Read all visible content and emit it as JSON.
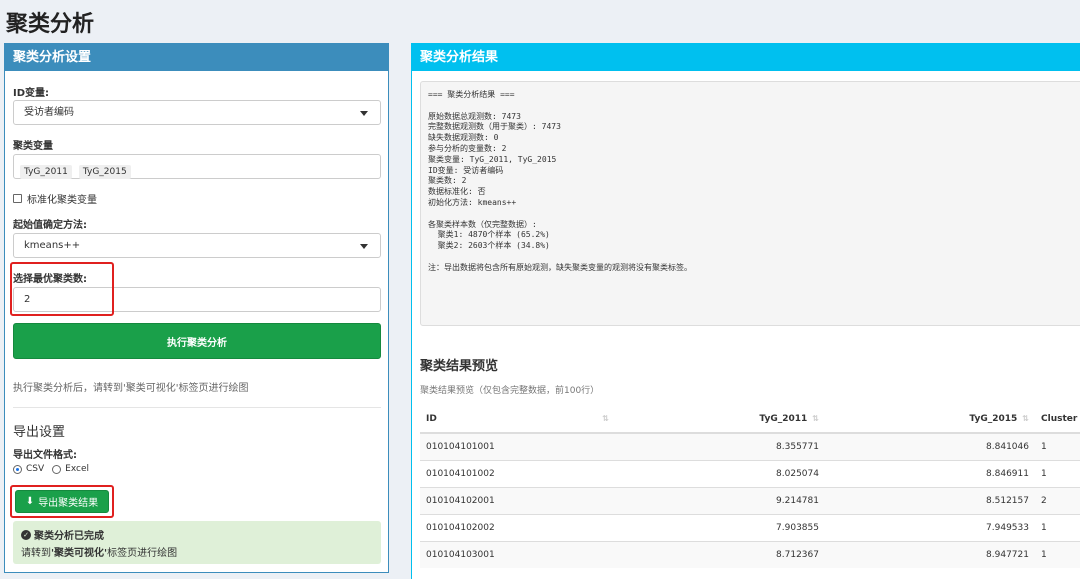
{
  "page_title": "聚类分析",
  "left_panel": {
    "header": "聚类分析设置",
    "id_var_label": "ID变量:",
    "id_var_value": "受访者编码",
    "cluster_var_label": "聚类变量",
    "cluster_vars": [
      "TyG_2011",
      "TyG_2015"
    ],
    "standardize_label": "标准化聚类变量",
    "init_label": "起始值确定方法:",
    "init_value": "kmeans++",
    "k_label": "选择最优聚类数:",
    "k_value": "2",
    "run_button": "执行聚类分析",
    "hint": "执行聚类分析后，请转到'聚类可视化'标签页进行绘图",
    "export_title": "导出设置",
    "format_label": "导出文件格式:",
    "format_options": [
      "CSV",
      "Excel"
    ],
    "format_selected": "CSV",
    "export_button": "导出聚类结果",
    "done_title": "聚类分析已完成",
    "done_msg_prefix": "请转到",
    "done_msg_bold": "'聚类可视化'",
    "done_msg_suffix": "标签页进行绘图",
    "accent_color": "#3c8dbc",
    "button_color": "#1aa04a",
    "highlight_color": "#e0201f"
  },
  "right_panel": {
    "header": "聚类分析结果",
    "output_text": "=== 聚类分析结果 ===\n\n原始数据总观测数: 7473\n完整数据观测数（用于聚类）: 7473\n缺失数据观测数: 0\n参与分析的变量数: 2\n聚类变量: TyG_2011, TyG_2015\nID变量: 受访者编码\n聚类数: 2\n数据标准化: 否\n初始化方法: kmeans++\n\n各聚类样本数（仅完整数据）:\n  聚类1: 4870个样本 (65.2%)\n  聚类2: 2603个样本 (34.8%)\n\n注：导出数据将包含所有原始观测，缺失聚类变量的观测将没有聚类标签。",
    "preview_title": "聚类结果预览",
    "preview_subtitle": "聚类结果预览（仅包含完整数据，前100行）",
    "table": {
      "columns": [
        "ID",
        "TyG_2011",
        "TyG_2015",
        "Cluster"
      ],
      "rows": [
        [
          "010104101001",
          "8.355771",
          "8.841046",
          "1"
        ],
        [
          "010104101002",
          "8.025074",
          "8.846911",
          "1"
        ],
        [
          "010104102001",
          "9.214781",
          "8.512157",
          "2"
        ],
        [
          "010104102002",
          "7.903855",
          "7.949533",
          "1"
        ],
        [
          "010104103001",
          "8.712367",
          "8.947721",
          "1"
        ]
      ]
    },
    "accent_color": "#00c0ef"
  }
}
